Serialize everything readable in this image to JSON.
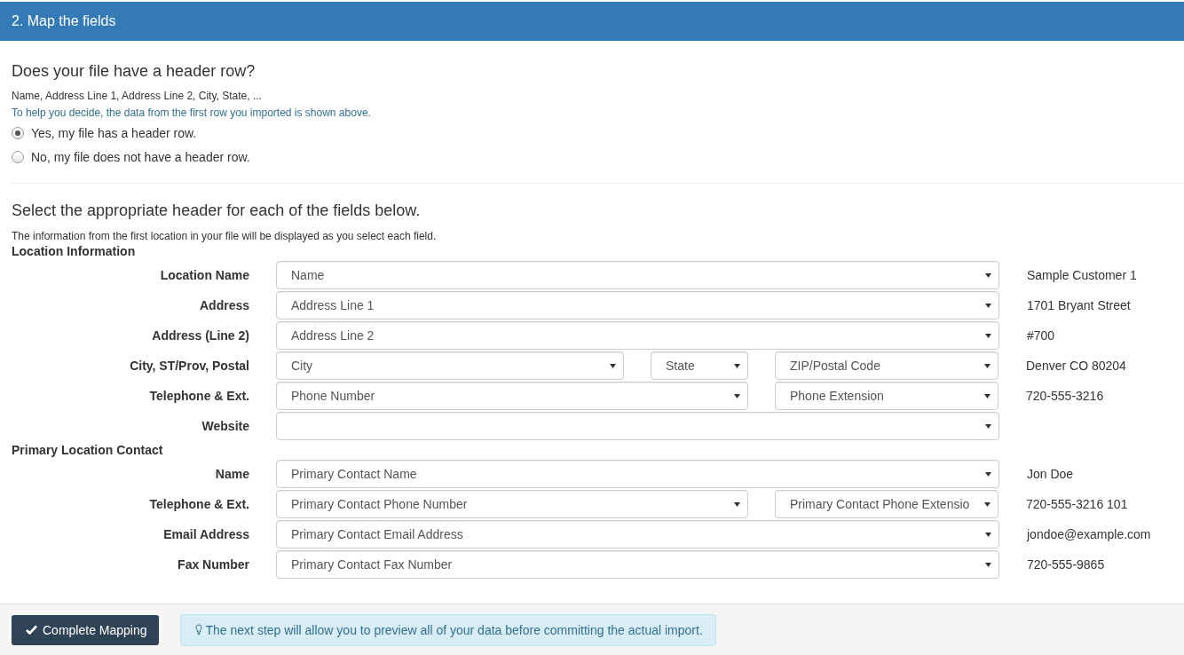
{
  "panel": {
    "title": "2. Map the fields"
  },
  "header_question": {
    "title": "Does your file have a header row?",
    "first_row": "Name, Address Line 1, Address Line 2, City, State, ...",
    "hint": "To help you decide, the data from the first row you imported is shown above.",
    "options": [
      {
        "label": "Yes, my file has a header row.",
        "selected": true
      },
      {
        "label": "No, my file does not have a header row.",
        "selected": false
      }
    ]
  },
  "mapping": {
    "title": "Select the appropriate header for each of the fields below.",
    "note": "The information from the first location in your file will be displayed as you select each field.",
    "sections": [
      {
        "title": "Location Information",
        "rows": [
          {
            "label": "Location Name",
            "selects": [
              {
                "value": "Name"
              }
            ],
            "sample": "Sample Customer 1"
          },
          {
            "label": "Address",
            "selects": [
              {
                "value": "Address Line 1"
              }
            ],
            "sample": "1701 Bryant Street"
          },
          {
            "label": "Address (Line 2)",
            "selects": [
              {
                "value": "Address Line 2"
              }
            ],
            "sample": "#700"
          },
          {
            "label": "City, ST/Prov, Postal",
            "selects": [
              {
                "value": "City"
              },
              {
                "value": "State"
              },
              {
                "value": "ZIP/Postal Code"
              }
            ],
            "sample": "Denver CO 80204"
          },
          {
            "label": "Telephone & Ext.",
            "selects": [
              {
                "value": "Phone Number"
              },
              {
                "value": "Phone Extension"
              }
            ],
            "sample": "720-555-3216"
          },
          {
            "label": "Website"
          }
        ]
      },
      {
        "title": "Primary Location Contact",
        "rows": [
          {
            "label": "Name",
            "selects": [
              {
                "value": "Primary Contact Name"
              }
            ],
            "sample": "Jon Doe"
          },
          {
            "label": "Telephone & Ext.",
            "selects": [
              {
                "value": "Primary Contact Phone Number"
              },
              {
                "value": "Primary Contact Phone Extensio"
              }
            ],
            "sample": "720-555-3216 101"
          },
          {
            "label": "Email Address",
            "selects": [
              {
                "value": "Primary Contact Email Address"
              }
            ],
            "sample": "jondoe@example.com"
          },
          {
            "label": "Fax Number",
            "selects": [
              {
                "value": "Primary Contact Fax Number"
              }
            ],
            "sample": "720-555-9865"
          }
        ]
      }
    ]
  },
  "footer": {
    "button": "Complete Mapping",
    "info": "The next step will allow you to preview all of your data before committing the actual import."
  }
}
